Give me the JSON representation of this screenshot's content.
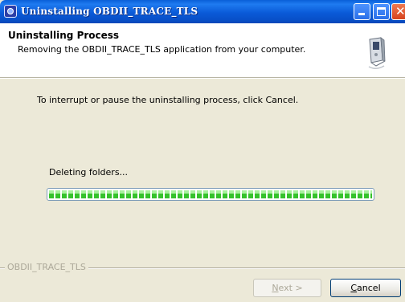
{
  "window": {
    "title": "Uninstalling OBDII_TRACE_TLS",
    "colors": {
      "titlebar": "#0a5ad8",
      "close": "#d6421d",
      "face": "#ece9d8"
    }
  },
  "header": {
    "title": "Uninstalling Process",
    "subtitle": "Removing the OBDII_TRACE_TLS application from your computer.",
    "image": "installer-device-icon"
  },
  "body": {
    "instruction": "To interrupt or pause the uninstalling process, click Cancel.",
    "status": "Deleting folders...",
    "progress_fraction": 1.0
  },
  "footer": {
    "brand": "OBDII_TRACE_TLS",
    "next_prefix": "N",
    "next_rest": "ext >",
    "cancel_prefix": "C",
    "cancel_rest": "ancel"
  }
}
